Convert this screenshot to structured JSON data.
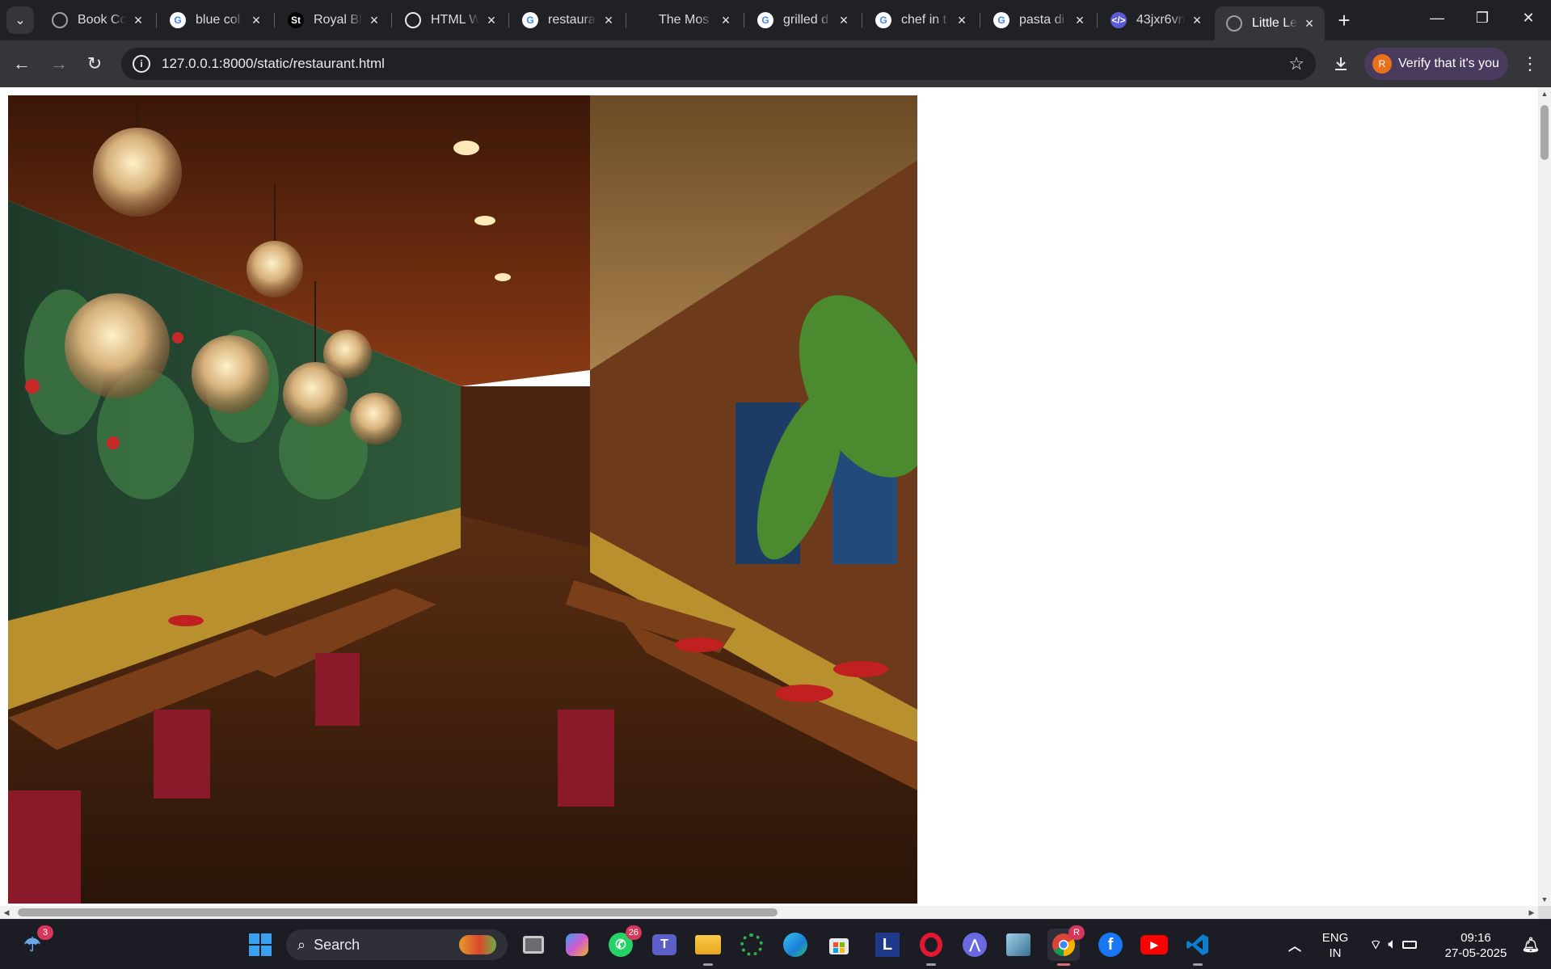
{
  "browser": {
    "tabs": [
      {
        "title": "Book Co",
        "icon": "globe-icon"
      },
      {
        "title": "blue col",
        "icon": "google-icon"
      },
      {
        "title": "Royal Bl",
        "icon": "st-icon"
      },
      {
        "title": "HTML W",
        "icon": "openai-icon"
      },
      {
        "title": "restaura",
        "icon": "google-icon"
      },
      {
        "title": "The Mos",
        "icon": "blank-icon"
      },
      {
        "title": "grilled d",
        "icon": "google-icon"
      },
      {
        "title": "chef in t",
        "icon": "google-icon"
      },
      {
        "title": "pasta di",
        "icon": "google-icon"
      },
      {
        "title": "43jxr6vn",
        "icon": "code-icon"
      },
      {
        "title": "Little Le",
        "icon": "globe-icon",
        "active": true
      }
    ],
    "address": {
      "url": "127.0.0.1:8000/static/restaurant.html"
    },
    "profile": {
      "verify_label": "Verify that it's you",
      "initial": "R"
    },
    "colors": {
      "frame": "#202124",
      "toolbar": "#35363a",
      "chip": "#4a3b5e"
    }
  },
  "page": {
    "hero_image": {
      "description": "restaurant-interior-photo"
    }
  },
  "taskbar": {
    "weather_badge": "3",
    "search_label": "Search",
    "whatsapp_badge": "26",
    "chrome_profile_badge": "R",
    "language": {
      "line1": "ENG",
      "line2": "IN"
    },
    "clock": {
      "time": "09:16",
      "date": "27-05-2025"
    }
  }
}
